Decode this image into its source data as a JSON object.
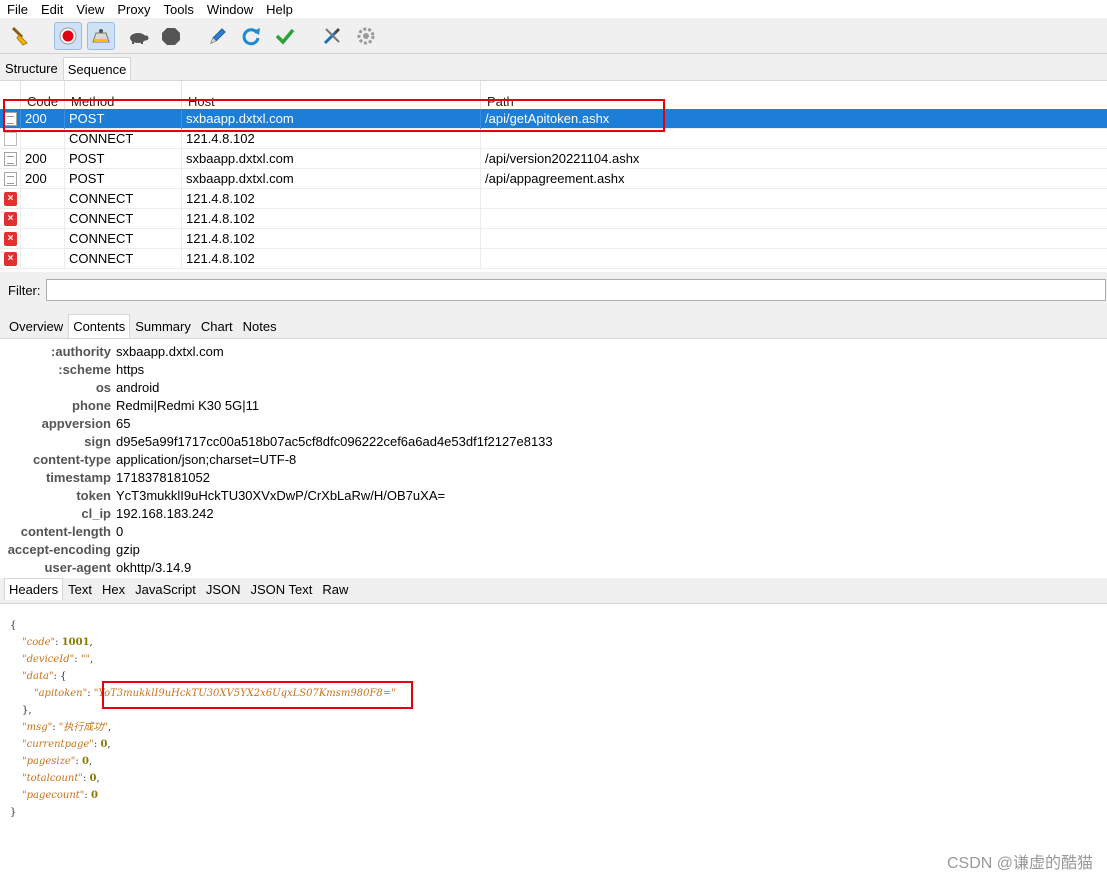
{
  "menu": [
    "File",
    "Edit",
    "View",
    "Proxy",
    "Tools",
    "Window",
    "Help"
  ],
  "toolbar_icons": [
    "broom-icon",
    "record-icon",
    "throttle-icon",
    "turtle-icon",
    "stop-icon",
    "pen-icon",
    "refresh-icon",
    "check-icon",
    "tools-icon",
    "settings-icon"
  ],
  "view_tabs": [
    "Structure",
    "Sequence"
  ],
  "active_view_tab": "Sequence",
  "table": {
    "columns": [
      "Code",
      "Method",
      "Host",
      "Path"
    ],
    "rows": [
      {
        "status": "doc",
        "code": "200",
        "method": "POST",
        "host": "sxbaapp.dxtxl.com",
        "path": "/api/getApitoken.ashx",
        "selected": true
      },
      {
        "status": "blank",
        "code": "",
        "method": "CONNECT",
        "host": "121.4.8.102",
        "path": ""
      },
      {
        "status": "doc",
        "code": "200",
        "method": "POST",
        "host": "sxbaapp.dxtxl.com",
        "path": "/api/version20221104.ashx"
      },
      {
        "status": "doc",
        "code": "200",
        "method": "POST",
        "host": "sxbaapp.dxtxl.com",
        "path": "/api/appagreement.ashx"
      },
      {
        "status": "error",
        "code": "",
        "method": "CONNECT",
        "host": "121.4.8.102",
        "path": ""
      },
      {
        "status": "error",
        "code": "",
        "method": "CONNECT",
        "host": "121.4.8.102",
        "path": ""
      },
      {
        "status": "error",
        "code": "",
        "method": "CONNECT",
        "host": "121.4.8.102",
        "path": ""
      },
      {
        "status": "error",
        "code": "",
        "method": "CONNECT",
        "host": "121.4.8.102",
        "path": ""
      }
    ]
  },
  "filter": {
    "label": "Filter:",
    "value": ""
  },
  "detail_tabs": [
    "Overview",
    "Contents",
    "Summary",
    "Chart",
    "Notes"
  ],
  "active_detail_tab": "Contents",
  "headers": [
    {
      "key": ":authority",
      "value": "sxbaapp.dxtxl.com"
    },
    {
      "key": ":scheme",
      "value": "https"
    },
    {
      "key": "os",
      "value": "android"
    },
    {
      "key": "phone",
      "value": "Redmi|Redmi K30 5G|11"
    },
    {
      "key": "appversion",
      "value": "65"
    },
    {
      "key": "sign",
      "value": "d95e5a99f1717cc00a518b07ac5cf8dfc096222cef6a6ad4e53df1f2127e8133"
    },
    {
      "key": "content-type",
      "value": "application/json;charset=UTF-8"
    },
    {
      "key": "timestamp",
      "value": "1718378181052"
    },
    {
      "key": "token",
      "value": "YcT3mukklI9uHckTU30XVxDwP/CrXbLaRw/H/OB7uXA="
    },
    {
      "key": "cl_ip",
      "value": "192.168.183.242"
    },
    {
      "key": "content-length",
      "value": "0"
    },
    {
      "key": "accept-encoding",
      "value": "gzip"
    },
    {
      "key": "user-agent",
      "value": "okhttp/3.14.9"
    }
  ],
  "response_tabs": [
    "Headers",
    "Text",
    "Hex",
    "JavaScript",
    "JSON",
    "JSON Text",
    "Raw"
  ],
  "active_response_tab": "Headers",
  "json": {
    "open": "{",
    "code_key": "\"code\"",
    "code_val": "1001",
    "deviceId_key": "\"deviceId\"",
    "deviceId_val": "\"\"",
    "data_key": "\"data\"",
    "data_open": "{",
    "apitoken_key": "\"apitoken\"",
    "apitoken_val": "\"YoT3mukklI9uHckTU30XV5YX2x6UqxLS07Kmsm980F8=\"",
    "data_close": "},",
    "msg_key": "\"msg\"",
    "msg_val": "\"执行成功\"",
    "currentpage_key": "\"currentpage\"",
    "currentpage_val": "0",
    "pagesize_key": "\"pagesize\"",
    "pagesize_val": "0",
    "totalcount_key": "\"totalcount\"",
    "totalcount_val": "0",
    "pagecount_key": "\"pagecount\"",
    "pagecount_val": "0",
    "close": "}"
  },
  "watermark": "CSDN @谦虚的酷猫",
  "colors": {
    "selection": "#1c7ed6",
    "highlight_box": "#e3000f",
    "json_string": "#c7741b",
    "json_number": "#8a7a00"
  }
}
